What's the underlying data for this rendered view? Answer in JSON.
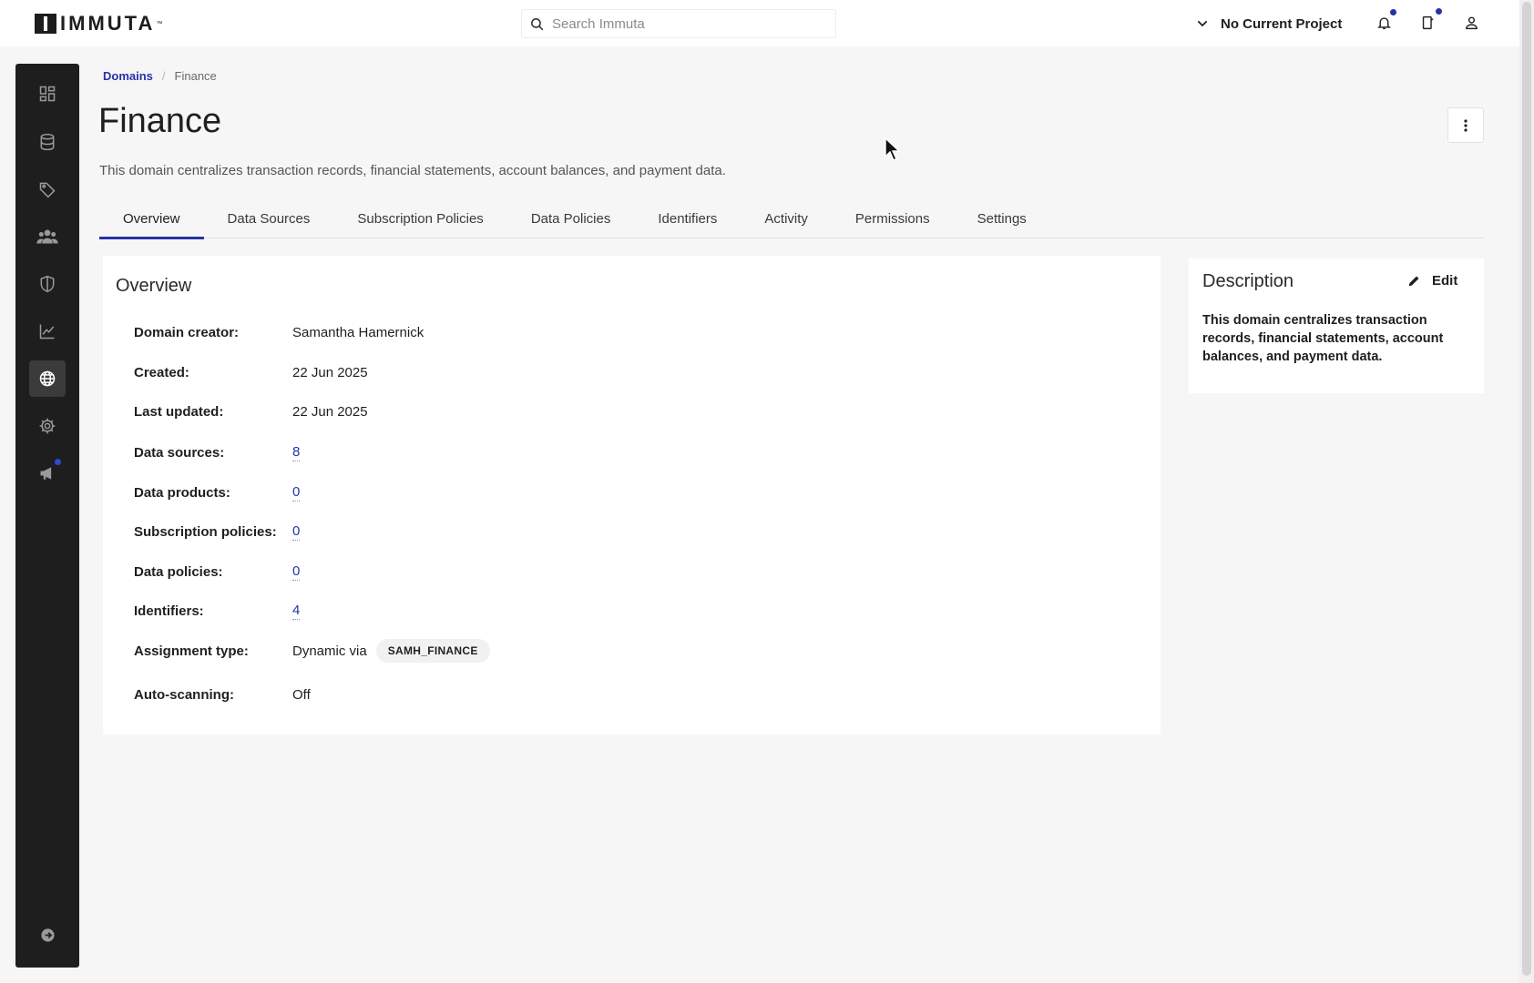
{
  "app": {
    "brand": "IMMUTA",
    "search_placeholder": "Search Immuta",
    "project_label": "No Current Project"
  },
  "breadcrumb": {
    "root": "Domains",
    "separator": "/",
    "current": "Finance"
  },
  "page": {
    "title": "Finance",
    "description": "This domain centralizes transaction records, financial statements, account balances, and payment data."
  },
  "tabs": [
    {
      "label": "Overview",
      "active": true
    },
    {
      "label": "Data Sources"
    },
    {
      "label": "Subscription Policies"
    },
    {
      "label": "Data Policies"
    },
    {
      "label": "Identifiers"
    },
    {
      "label": "Activity"
    },
    {
      "label": "Permissions"
    },
    {
      "label": "Settings"
    }
  ],
  "overview": {
    "title": "Overview",
    "rows": [
      {
        "label": "Domain creator:",
        "value": "Samantha Hamernick"
      },
      {
        "label": "Created:",
        "value": "22 Jun 2025"
      },
      {
        "label": "Last updated:",
        "value": "22 Jun 2025"
      },
      {
        "label": "Data sources:",
        "value": "8"
      },
      {
        "label": "Data products:",
        "value": "0"
      },
      {
        "label": "Subscription policies:",
        "value": "0"
      },
      {
        "label": "Data policies:",
        "value": "0"
      },
      {
        "label": "Identifiers:",
        "value": "4"
      },
      {
        "label": "Assignment type:",
        "value": "Dynamic via",
        "tag": "SAMH_FINANCE"
      },
      {
        "label": "Auto-scanning:",
        "value": "Off"
      }
    ]
  },
  "description_panel": {
    "title": "Description",
    "edit_label": "Edit",
    "text": "This domain centralizes transaction records, financial statements, account balances, and payment data."
  },
  "colors": {
    "accent": "#2633a8",
    "sidebar": "#1e1e1e",
    "background": "#f6f6f6"
  },
  "icons": {
    "sidebar": [
      "dashboard-icon",
      "database-icon",
      "tag-icon",
      "people-icon",
      "shield-icon",
      "chart-icon",
      "globe-icon",
      "gear-icon",
      "megaphone-icon",
      "collapse-arrow-icon"
    ],
    "topbar": [
      "search-icon",
      "chevron-down-icon",
      "bell-icon",
      "requests-icon",
      "user-icon"
    ]
  }
}
